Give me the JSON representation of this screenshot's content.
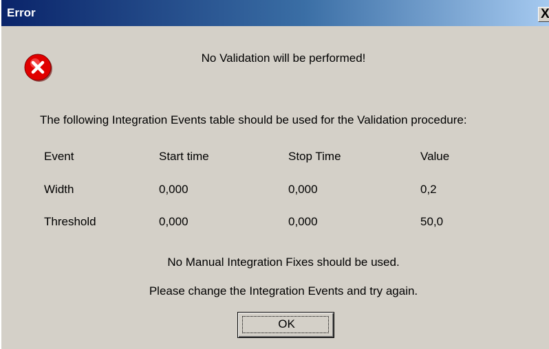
{
  "dialog": {
    "title": "Error",
    "close_label": "X",
    "message": "No Validation will be performed!",
    "intro": "The following Integration Events table should be used for the Validation procedure:",
    "table": {
      "headers": [
        "Event",
        "Start time",
        "Stop Time",
        "Value"
      ],
      "rows": [
        [
          "Width",
          "0,000",
          "0,000",
          "0,2"
        ],
        [
          "Threshold",
          "0,000",
          "0,000",
          "50,0"
        ]
      ]
    },
    "note_fixes": "No Manual Integration Fixes should be used.",
    "note_retry": "Please change the Integration Events and try again.",
    "ok_label": "OK"
  },
  "icons": {
    "error": "error-icon"
  },
  "colors": {
    "titlebar_start": "#0a246a",
    "titlebar_end": "#a6caf0",
    "error_red": "#e00000",
    "dialog_bg": "#d4d0c8"
  }
}
